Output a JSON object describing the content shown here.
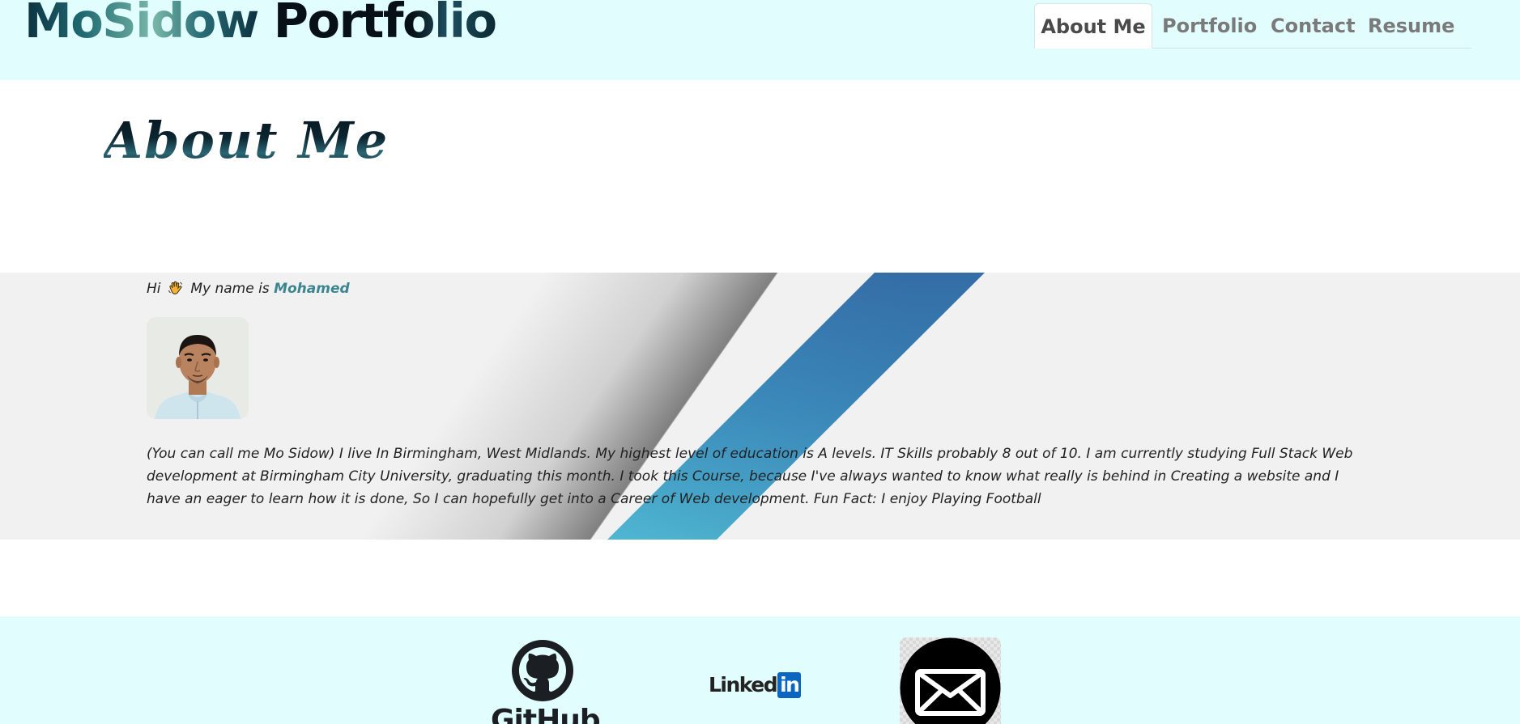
{
  "header": {
    "logo_first": "MoSidow",
    "logo_second": "Portfolio",
    "nav": [
      {
        "label": "About Me",
        "active": true
      },
      {
        "label": "Portfolio",
        "active": false
      },
      {
        "label": "Contact",
        "active": false
      },
      {
        "label": "Resume",
        "active": false
      }
    ]
  },
  "about": {
    "title": "About Me",
    "greeting_prefix": "Hi",
    "greeting_middle": "My name is",
    "name": "Mohamed",
    "bio": "(You can call me Mo Sidow) I live In Birmingham, West Midlands. My highest level of education is A levels. IT Skills probably 8 out of 10. I am currently studying Full Stack Web development at Birmingham City University, graduating this month. I took this Course, because I've always wanted to know what really is behind in Creating a website and I have an eager to learn how it is done, So I can hopefully get into a Career of Web development. Fun Fact: I enjoy Playing Football"
  },
  "footer": {
    "github_label": "GitHub",
    "linkedin_word": "Linked",
    "linkedin_in": "in",
    "icons": [
      "github-icon",
      "linkedin-icon",
      "mail-icon"
    ]
  },
  "colors": {
    "header_bg": "#e1fdfd",
    "section_bg": "#f1f1f1",
    "name_accent": "#3b8590",
    "stripe_blue": "#3e92bf"
  }
}
